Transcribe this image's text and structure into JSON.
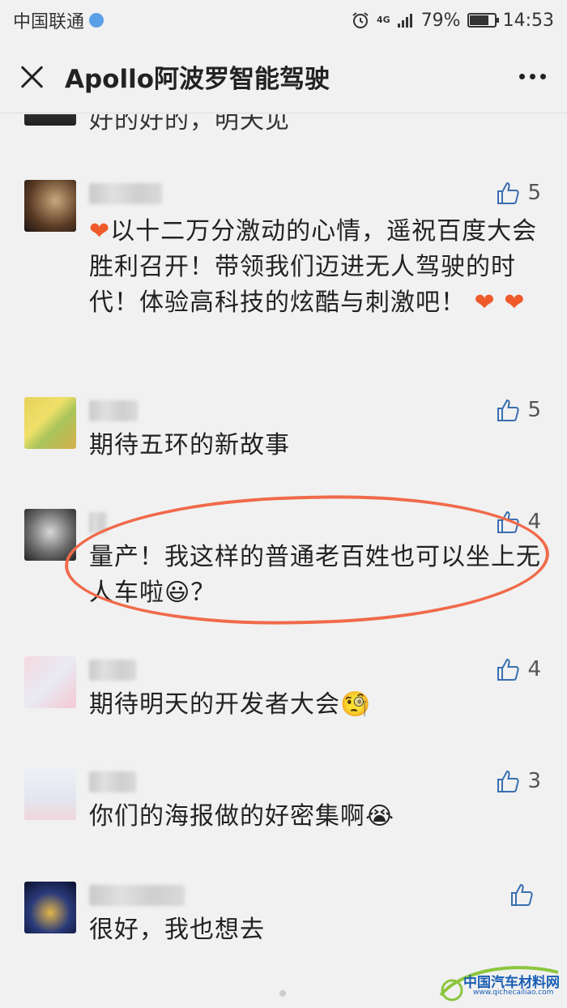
{
  "status": {
    "carrier": "中国联通",
    "network": "4G",
    "battery": "79%",
    "battery_level": 0.79,
    "time": "14:53"
  },
  "header": {
    "title": "Apollo阿波罗智能驾驶"
  },
  "comments": [
    {
      "text": "好的好的，明天见",
      "likes": ""
    },
    {
      "text_before": "以十二万分激动的心情，遥祝百度大会胜利召开！带领我们迈进无人驾驶的时代！体验高科技的炫酷与刺激吧！",
      "likes": "5"
    },
    {
      "text": "期待五环的新故事",
      "likes": "5"
    },
    {
      "text": "量产！我这样的普通老百姓也可以坐上无人车啦",
      "text_after": "？",
      "likes": "4"
    },
    {
      "text": "期待明天的开发者大会",
      "likes": "4"
    },
    {
      "text": "你们的海报做的好密集啊",
      "likes": "3"
    },
    {
      "text": "很好，我也想去",
      "likes": ""
    }
  ],
  "watermark": {
    "text": "中国汽车材料网",
    "url": "www.qichecailiao.com"
  },
  "colors": {
    "background": "#f1f1f1",
    "highlight": "#f06a4a",
    "heart": "#ef5a2a"
  }
}
